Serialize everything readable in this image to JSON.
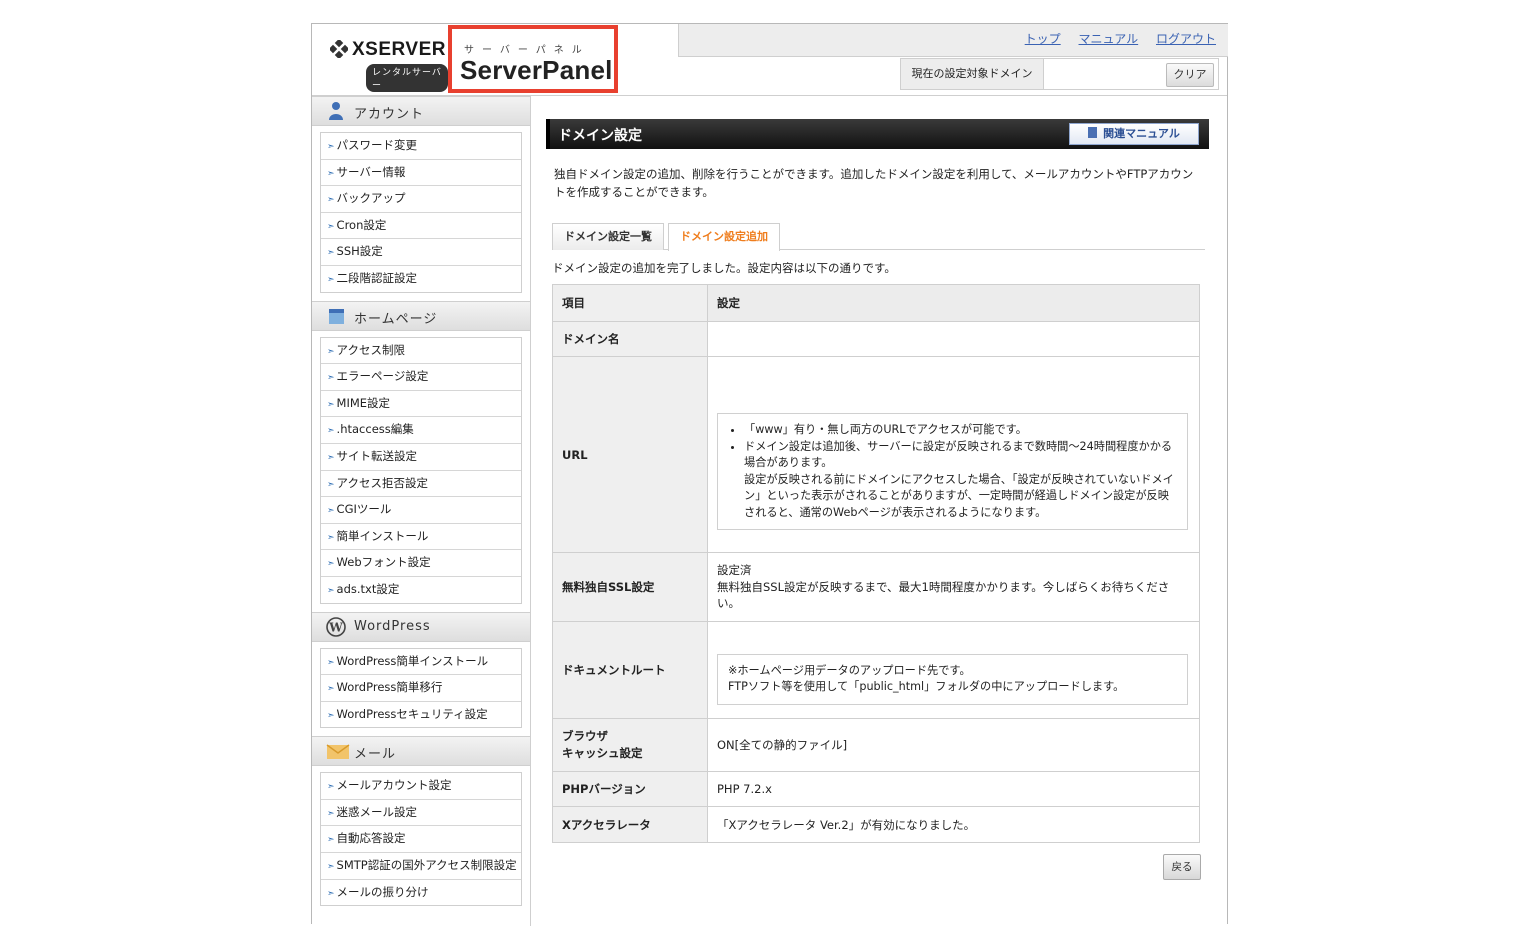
{
  "brand": {
    "logo_text": "XSERVER",
    "logo_sub": "レンタルサーバー",
    "panel_kana": "サーバーパネル",
    "panel_title": "ServerPanel"
  },
  "header": {
    "links": [
      "トップ",
      "マニュアル",
      "ログアウト"
    ],
    "domain_label": "現在の設定対象ドメイン",
    "domain_value": "",
    "clear_label": "クリア"
  },
  "sidebar": [
    {
      "title": "アカウント",
      "icon": "user-icon",
      "items": [
        "パスワード変更",
        "サーバー情報",
        "バックアップ",
        "Cron設定",
        "SSH設定",
        "二段階認証設定"
      ]
    },
    {
      "title": "ホームページ",
      "icon": "homepage-icon",
      "items": [
        "アクセス制限",
        "エラーページ設定",
        "MIME設定",
        ".htaccess編集",
        "サイト転送設定",
        "アクセス拒否設定",
        "CGIツール",
        "簡単インストール",
        "Webフォント設定",
        "ads.txt設定"
      ]
    },
    {
      "title": "WordPress",
      "icon": "wordpress-icon",
      "items": [
        "WordPress簡単インストール",
        "WordPress簡単移行",
        "WordPressセキュリティ設定"
      ]
    },
    {
      "title": "メール",
      "icon": "mail-icon",
      "items": [
        "メールアカウント設定",
        "迷惑メール設定",
        "自動応答設定",
        "SMTP認証の国外アクセス制限設定",
        "メールの振り分け"
      ]
    }
  ],
  "main": {
    "title": "ドメイン設定",
    "manual_button": "関連マニュアル",
    "intro": "独自ドメイン設定の追加、削除を行うことができます。追加したドメイン設定を利用して、メールアカウントやFTPアカウントを作成することができます。",
    "tabs": [
      "ドメイン設定一覧",
      "ドメイン設定追加"
    ],
    "complete_text": "ドメイン設定の追加を完了しました。設定内容は以下の通りです。",
    "table": {
      "header": [
        "項目",
        "設定"
      ],
      "rows": {
        "domain_name": {
          "key": "ドメイン名",
          "value": ""
        },
        "url": {
          "key": "URL",
          "notes": [
            "「www」有り・無し両方のURLでアクセスが可能です。",
            "ドメイン設定は追加後、サーバーに設定が反映されるまで数時間〜24時間程度かかる場合があります。"
          ],
          "note_cont": "設定が反映される前にドメインにアクセスした場合、「設定が反映されていないドメイン」といった表示がされることがありますが、一定時間が経過しドメイン設定が反映されると、通常のWebページが表示されるようになります。"
        },
        "ssl": {
          "key": "無料独自SSL設定",
          "line1": "設定済",
          "line2": "無料独自SSL設定が反映するまで、最大1時間程度かかります。今しばらくお待ちください。"
        },
        "docroot": {
          "key": "ドキュメントルート",
          "note1": "※ホームページ用データのアップロード先です。",
          "note2": "FTPソフト等を使用して「public_html」フォルダの中にアップロードします。"
        },
        "cache": {
          "key1": "ブラウザ",
          "key2": "キャッシュ設定",
          "value": "ON[全ての静的ファイル]"
        },
        "php": {
          "key": "PHPバージョン",
          "value": "PHP 7.2.x"
        },
        "xacc": {
          "key": "Xアクセラレータ",
          "value": "「Xアクセラレータ Ver.2」が有効になりました。"
        }
      }
    },
    "back_button": "戻る"
  },
  "colors": {
    "highlight": "#e8402f",
    "link": "#3a62b3",
    "active_tab": "#ef7d1d",
    "title_bar": "#111111"
  }
}
